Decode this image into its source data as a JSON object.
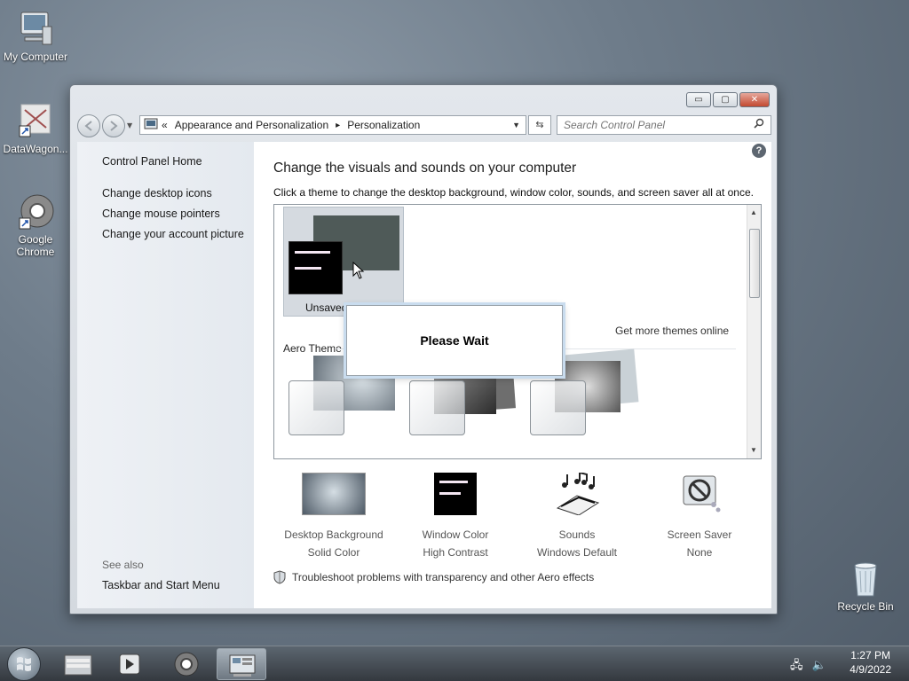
{
  "desktop": {
    "icons": [
      {
        "label": "My Computer"
      },
      {
        "label": "DataWagon..."
      },
      {
        "label": "Google Chrome"
      },
      {
        "label": "Recycle Bin"
      }
    ]
  },
  "window": {
    "caption_buttons": {
      "minimize": "▭",
      "maximize": "▢",
      "close": "✕"
    },
    "address": {
      "chevron": "«",
      "crumbs": [
        "Appearance and Personalization",
        "Personalization"
      ],
      "separator": "▸"
    },
    "search": {
      "placeholder": "Search Control Panel"
    },
    "left_pane": {
      "home": "Control Panel Home",
      "links": [
        "Change desktop icons",
        "Change mouse pointers",
        "Change your account picture"
      ],
      "see_also_heading": "See also",
      "see_also_links": [
        "Taskbar and Start Menu"
      ]
    },
    "content": {
      "title": "Change the visuals and sounds on your computer",
      "subtitle": "Click a theme to change the desktop background, window color, sounds, and screen saver all at once.",
      "unsaved_theme_label": "Unsaved",
      "get_more_link": "Get more themes online",
      "aero_heading": "Aero Theme",
      "dialog_text": "Please Wait",
      "options": [
        {
          "title": "Desktop Background",
          "value": "Solid Color"
        },
        {
          "title": "Window Color",
          "value": "High Contrast"
        },
        {
          "title": "Sounds",
          "value": "Windows Default"
        },
        {
          "title": "Screen Saver",
          "value": "None"
        }
      ],
      "troubleshoot_link": "Troubleshoot problems with transparency and other Aero effects"
    }
  },
  "taskbar": {
    "time": "1:27 PM",
    "date": "4/9/2022"
  }
}
